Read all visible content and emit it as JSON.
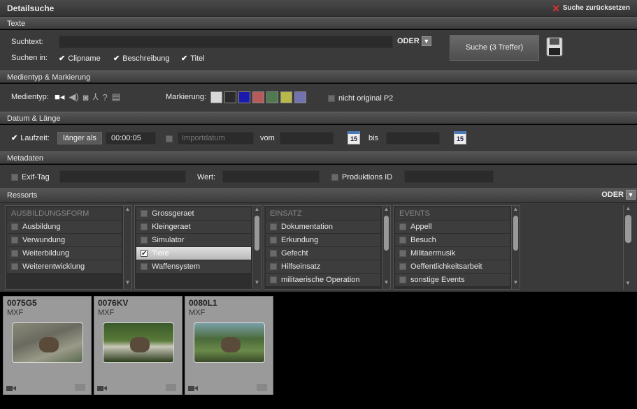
{
  "header": {
    "title": "Detailsuche",
    "reset_label": "Suche zurücksetzen"
  },
  "texte": {
    "section_title": "Texte",
    "suchtext_label": "Suchtext:",
    "suchtext_value": "",
    "operator": "ODER",
    "suchen_in_label": "Suchen in:",
    "fields": [
      {
        "label": "Clipname",
        "checked": true
      },
      {
        "label": "Beschreibung",
        "checked": true
      },
      {
        "label": "Titel",
        "checked": true
      }
    ],
    "search_button": "Suche (3 Treffer)"
  },
  "medien": {
    "section_title": "Medientyp & Markierung",
    "medientyp_label": "Medientyp:",
    "markierung_label": "Markierung:",
    "swatches": [
      "#d8d8d8",
      "#2a2a2a",
      "#1a1ab0",
      "#b85a5a",
      "#4f7a4f",
      "#b8b84a",
      "#7272b0"
    ],
    "p2_label": "nicht original P2"
  },
  "datum": {
    "section_title": "Datum & Länge",
    "laufzeit_label": "Laufzeit:",
    "laufzeit_mode": "länger als",
    "laufzeit_value": "00:00:05",
    "importdatum_placeholder": "Importdatum",
    "vom_label": "vom",
    "bis_label": "bis",
    "calendar_day": "15"
  },
  "metadaten": {
    "section_title": "Metadaten",
    "exif_label": "Exif-Tag",
    "wert_label": "Wert:",
    "produktions_label": "Produktions ID"
  },
  "ressorts": {
    "section_title": "Ressorts",
    "operator": "ODER",
    "lists": [
      {
        "header": "AUSBILDUNGSFORM",
        "items": [
          {
            "label": "Ausbildung"
          },
          {
            "label": "Verwundung"
          },
          {
            "label": "Weiterbildung"
          },
          {
            "label": "Weiterentwicklung"
          }
        ]
      },
      {
        "header": "",
        "items": [
          {
            "label": "Grossgeraet"
          },
          {
            "label": "Kleingeraet"
          },
          {
            "label": "Simulator"
          },
          {
            "label": "Tiere",
            "selected": true
          },
          {
            "label": "Waffensystem"
          }
        ]
      },
      {
        "header": "EINSATZ",
        "items": [
          {
            "label": "Dokumentation"
          },
          {
            "label": "Erkundung"
          },
          {
            "label": "Gefecht"
          },
          {
            "label": "Hilfseinsatz"
          },
          {
            "label": "militaerische Operation"
          }
        ]
      },
      {
        "header": "EVENTS",
        "items": [
          {
            "label": "Appell"
          },
          {
            "label": "Besuch"
          },
          {
            "label": "Militaermusik"
          },
          {
            "label": "Oeffentlichkeitsarbeit"
          },
          {
            "label": "sonstige Events"
          }
        ]
      }
    ]
  },
  "results": [
    {
      "id": "0075G5",
      "type": "MXF"
    },
    {
      "id": "0076KV",
      "type": "MXF"
    },
    {
      "id": "0080L1",
      "type": "MXF"
    }
  ]
}
